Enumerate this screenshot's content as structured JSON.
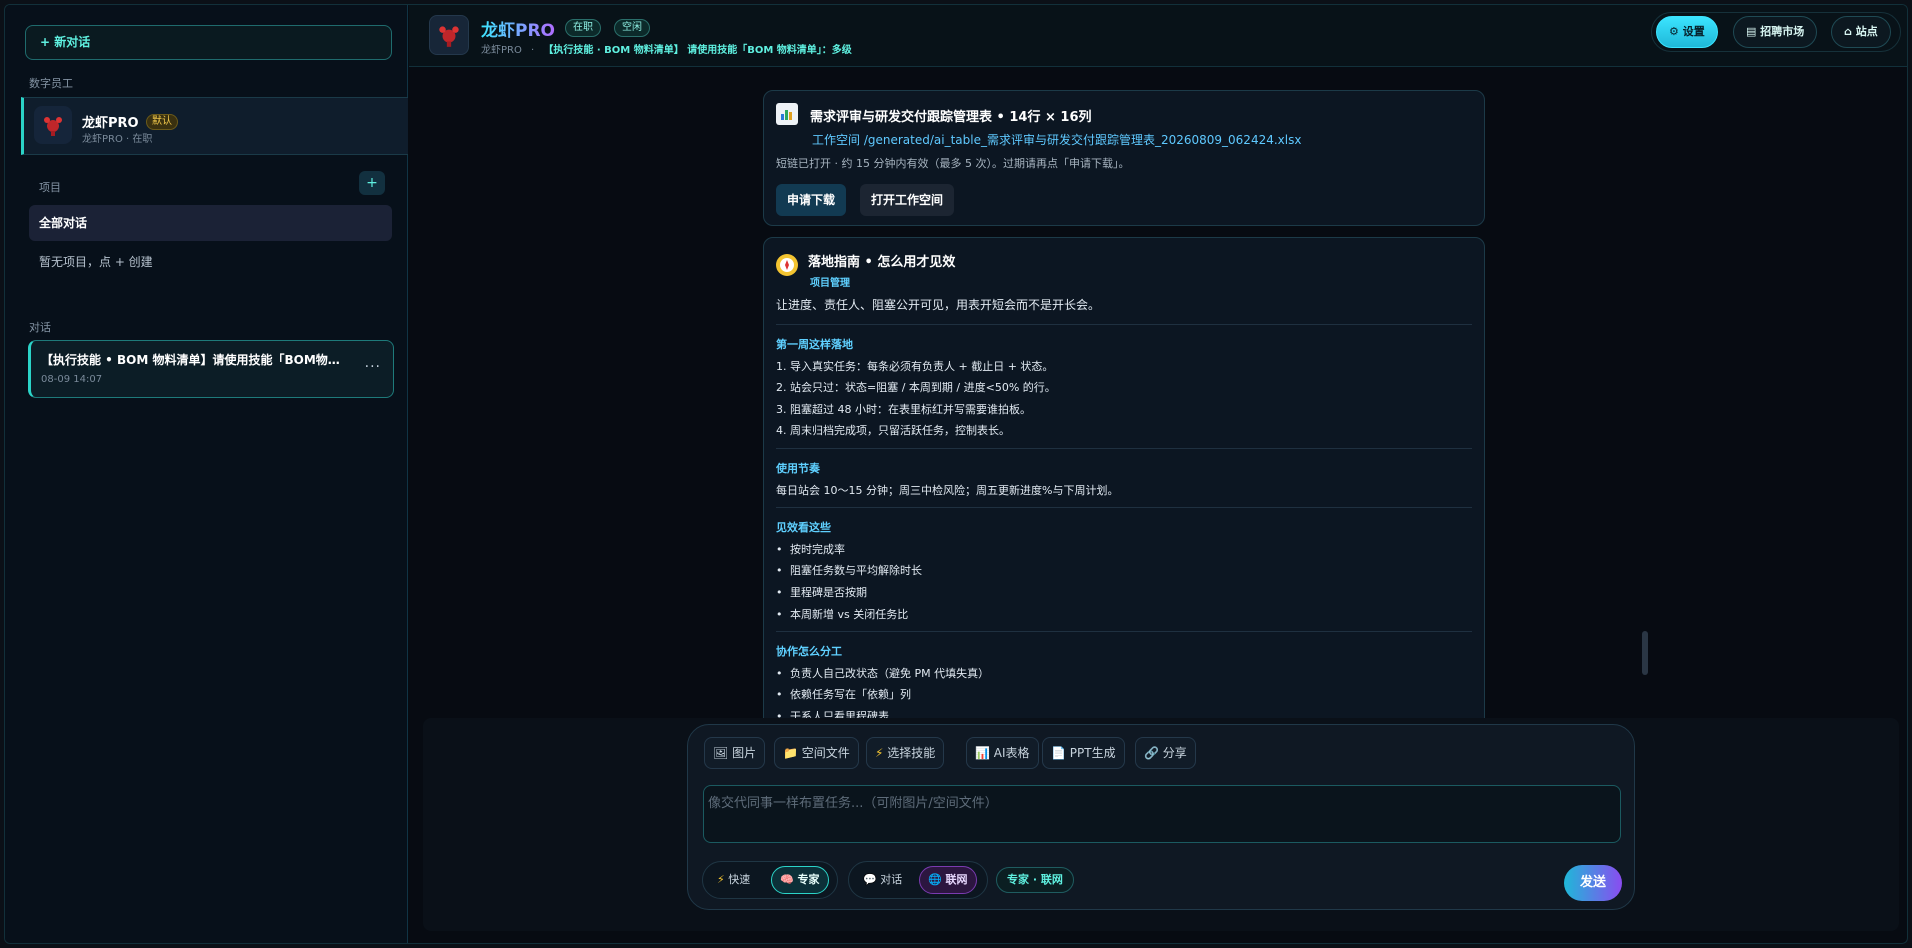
{
  "sidebar": {
    "new_chat": "+ 新对话",
    "section_staff": "数字员工",
    "staff": {
      "name": "龙虾PRO",
      "badge": "默认",
      "sub": "龙虾PRO · 在职"
    },
    "section_project": "项目",
    "project_add": "+",
    "all_chats": "全部对话",
    "no_project": "暂无项目，点 + 创建",
    "section_chats": "对话",
    "conversation": {
      "title": "【执行技能 • BOM 物料清单】请使用技能「BOM物料清单」：多级",
      "time": "08-09 14:07",
      "more": "···"
    }
  },
  "header": {
    "title": "龙虾PRO",
    "pill_status": "在职",
    "pill_mode": "空闲",
    "sub_name": "龙虾PRO",
    "sub_sep": "·",
    "sub_task": "【执行技能 · BOM 物料清单】 请使用技能「BOM 物料清单」：多级",
    "buttons": {
      "settings": "设置",
      "market": "招聘市场",
      "site": "站点"
    }
  },
  "file_card": {
    "title": "需求评审与研发交付跟踪管理表 • 14行 × 16列",
    "path": "工作空间 /generated/ai_table_需求评审与研发交付跟踪管理表_20260809_062424.xlsx",
    "note": "短链已打开 · 约 15 分钟内有效（最多 5 次）。过期请再点「申请下载」。",
    "download_btn": "申请下载",
    "open_btn": "打开工作空间"
  },
  "guide_card": {
    "title": "落地指南 • 怎么用才见效",
    "tag": "项目管理",
    "lead": "让进度、责任人、阻塞公开可见，用表开短会而不是开长会。",
    "sec1_title": "第一周这样落地",
    "sec1_items": [
      "1. 导入真实任务：每条必须有负责人 + 截止日 + 状态。",
      "2. 站会只过：状态=阻塞 / 本周到期 / 进度<50% 的行。",
      "3. 阻塞超过 48 小时：在表里标红并写需要谁拍板。",
      "4. 周末归档完成项，只留活跃任务，控制表长。"
    ],
    "sec2_title": "使用节奏",
    "sec2_text": "每日站会 10～15 分钟；周三中检风险；周五更新进度%与下周计划。",
    "sec3_title": "见效看这些",
    "sec3_items": [
      "按时完成率",
      "阻塞任务数与平均解除时长",
      "里程碑是否按期",
      "本周新增 vs 关闭任务比"
    ],
    "sec4_title": "协作怎么分工",
    "sec4_items": [
      "负责人自己改状态（避免 PM 代填失真）",
      "依赖任务写在「依赖」列",
      "干系人只看里程碑表"
    ]
  },
  "composer": {
    "tools": {
      "image": "图片",
      "files": "空间文件",
      "skill": "选择技能",
      "ai_table": "AI表格",
      "ppt": "PPT生成",
      "share": "分享"
    },
    "placeholder": "像交代同事一样布置任务...（可附图片/空间文件）",
    "speed_fast": "快速",
    "speed_expert": "专家",
    "chat_mode": "对话",
    "net_mode": "联网",
    "status": "专家 · 联网",
    "send": "发送"
  },
  "colors": {
    "accent": "#2bd4c8",
    "link": "#5fc9ff",
    "brand_gradient_start": "#3ce6ff",
    "brand_gradient_end": "#b06cff"
  }
}
